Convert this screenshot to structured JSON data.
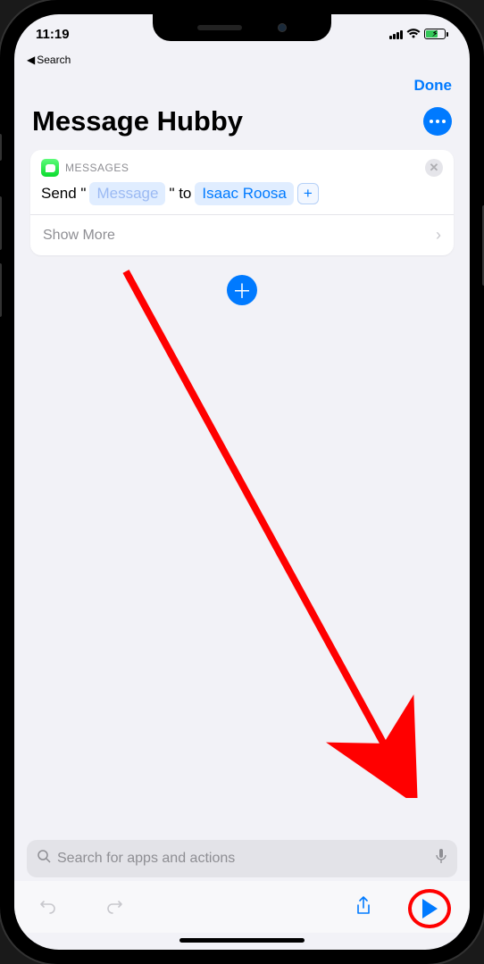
{
  "status": {
    "time": "11:19"
  },
  "back": {
    "label": "Search"
  },
  "nav": {
    "done": "Done"
  },
  "title": "Message Hubby",
  "action_card": {
    "app_label": "MESSAGES",
    "prefix": "Send \"",
    "message_token": "Message",
    "mid": "\" to",
    "recipient": "Isaac Roosa",
    "show_more": "Show More"
  },
  "search": {
    "placeholder": "Search for apps and actions"
  }
}
